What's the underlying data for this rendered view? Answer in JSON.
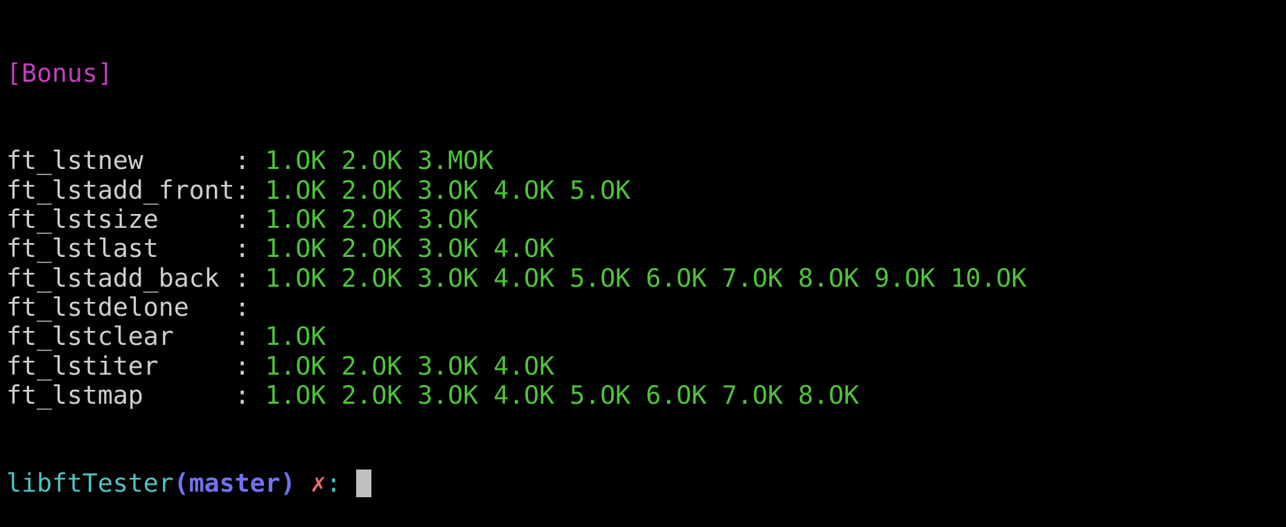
{
  "header": "[Bonus]",
  "separator": ": ",
  "tests": [
    {
      "name": "ft_lstnew",
      "results": [
        "1.OK",
        "2.OK",
        "3.MOK"
      ]
    },
    {
      "name": "ft_lstadd_front",
      "results": [
        "1.OK",
        "2.OK",
        "3.OK",
        "4.OK",
        "5.OK"
      ]
    },
    {
      "name": "ft_lstsize",
      "results": [
        "1.OK",
        "2.OK",
        "3.OK"
      ]
    },
    {
      "name": "ft_lstlast",
      "results": [
        "1.OK",
        "2.OK",
        "3.OK",
        "4.OK"
      ]
    },
    {
      "name": "ft_lstadd_back",
      "results": [
        "1.OK",
        "2.OK",
        "3.OK",
        "4.OK",
        "5.OK",
        "6.OK",
        "7.OK",
        "8.OK",
        "9.OK",
        "10.OK"
      ]
    },
    {
      "name": "ft_lstdelone",
      "results": []
    },
    {
      "name": "ft_lstclear",
      "results": [
        "1.OK"
      ]
    },
    {
      "name": "ft_lstiter",
      "results": [
        "1.OK",
        "2.OK",
        "3.OK",
        "4.OK"
      ]
    },
    {
      "name": "ft_lstmap",
      "results": [
        "1.OK",
        "2.OK",
        "3.OK",
        "4.OK",
        "5.OK",
        "6.OK",
        "7.OK",
        "8.OK"
      ]
    }
  ],
  "prompt": {
    "dir": "libftTester",
    "branch": "(master)",
    "dirty": "✗",
    "suffix": ":"
  },
  "colors": {
    "header": "#c040c0",
    "ok": "#4fc43a",
    "text": "#cfcfcf",
    "dir": "#4fc4c4",
    "branch": "#6f73f0",
    "dirty": "#e8706a"
  }
}
